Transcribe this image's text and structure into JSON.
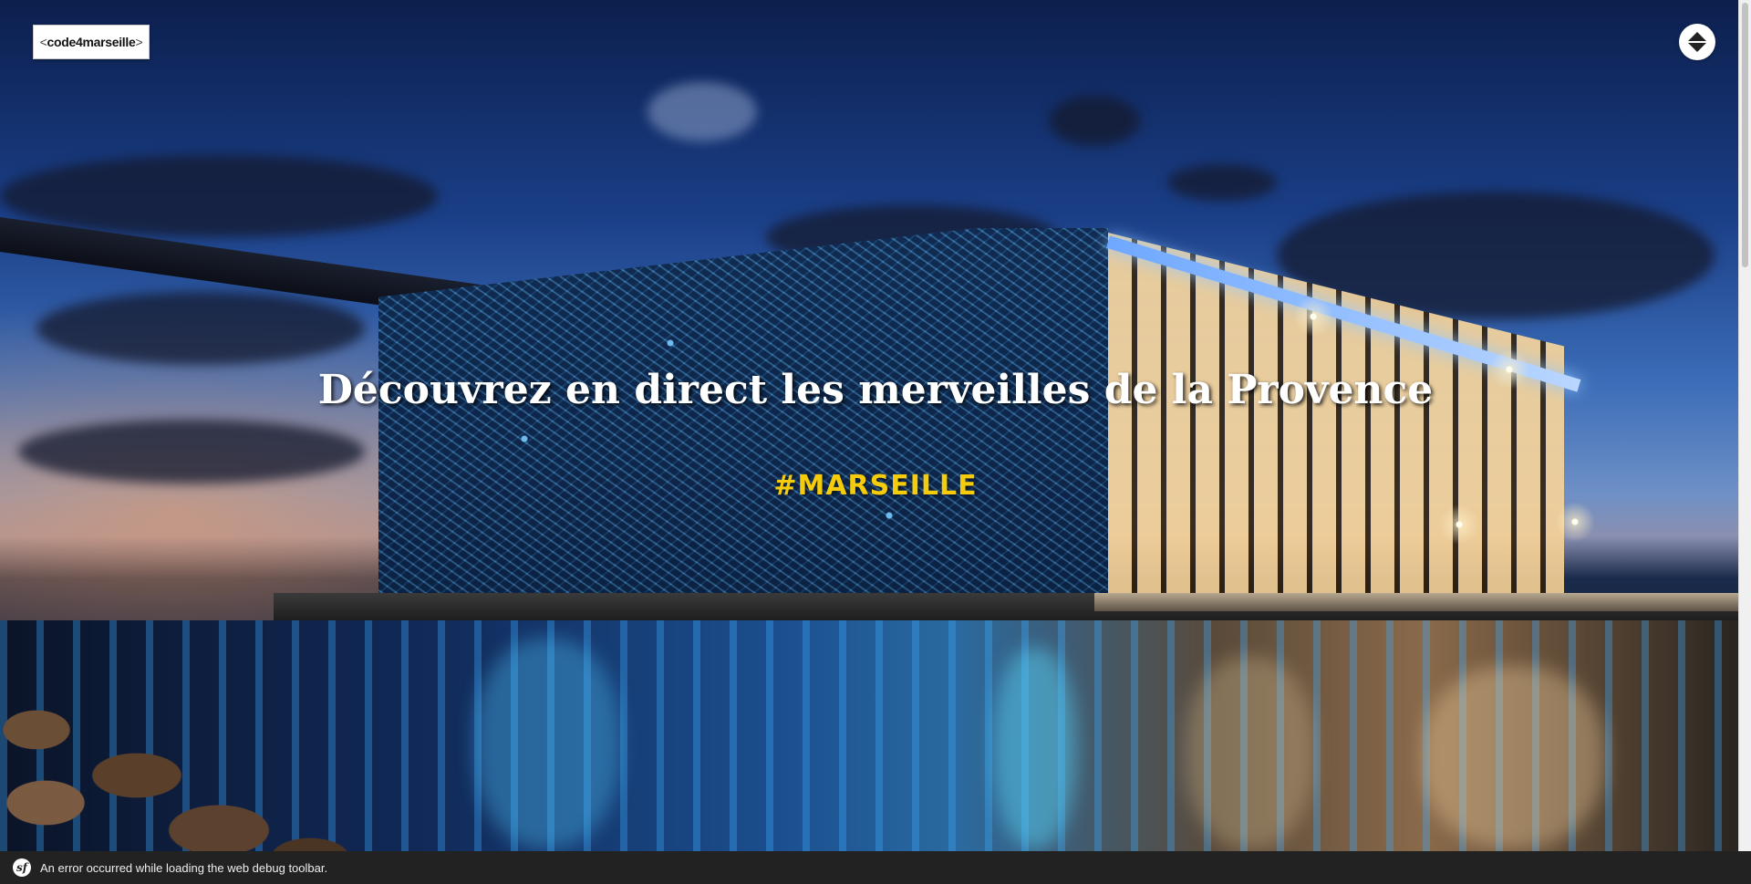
{
  "header": {
    "logo": {
      "bracket_open": "<",
      "text": "code4marseille",
      "bracket_close": ">"
    },
    "scroll_toggle_icon": "up-down-arrows-icon"
  },
  "hero": {
    "headline": "Découvrez en direct les merveilles de la Provence",
    "hashtag": "#MARSEILLE",
    "hashtag_color": "#f5cc0b"
  },
  "debug_toolbar": {
    "icon": "symfony-icon",
    "icon_glyph": "sf",
    "message": "An error occurred while loading the web debug toolbar."
  }
}
